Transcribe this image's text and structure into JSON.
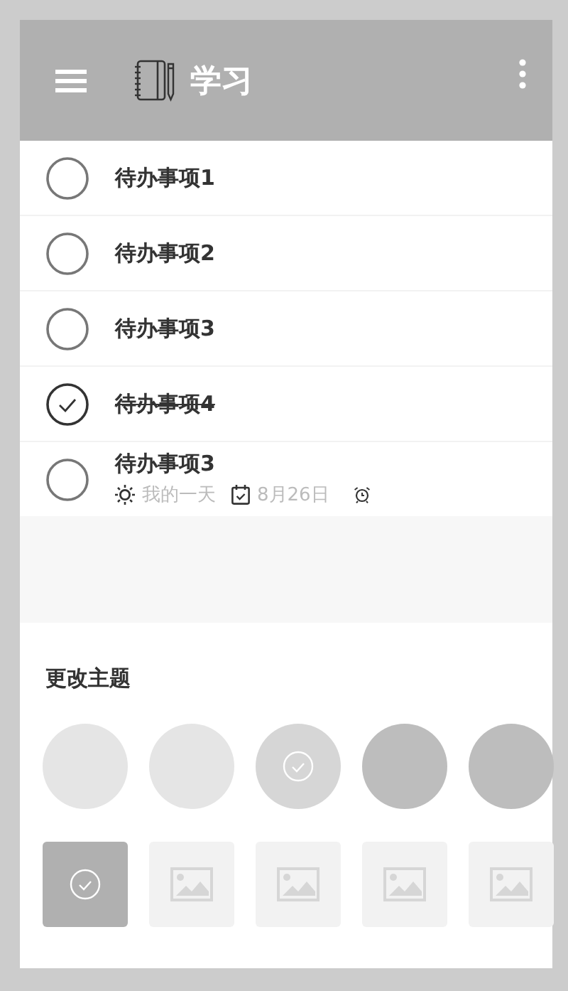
{
  "header": {
    "title": "学习"
  },
  "todos": [
    {
      "title": "待办事项1",
      "completed": false
    },
    {
      "title": "待办事项2",
      "completed": false
    },
    {
      "title": "待办事项3",
      "completed": false
    },
    {
      "title": "待办事项4",
      "completed": true
    },
    {
      "title": "待办事项3",
      "completed": false,
      "my_day": "我的一天",
      "due": "8月26日",
      "reminder": true
    }
  ],
  "theme": {
    "title": "更改主题",
    "colors": [
      {
        "color": "#e5e5e5",
        "selected": false
      },
      {
        "color": "#e5e5e5",
        "selected": false
      },
      {
        "color": "#d6d6d6",
        "selected": true
      },
      {
        "color": "#bdbdbd",
        "selected": false
      },
      {
        "color": "#bdbdbd",
        "selected": false
      }
    ],
    "backgrounds": [
      {
        "selected": true
      },
      {
        "selected": false
      },
      {
        "selected": false
      },
      {
        "selected": false
      },
      {
        "selected": false
      }
    ]
  }
}
